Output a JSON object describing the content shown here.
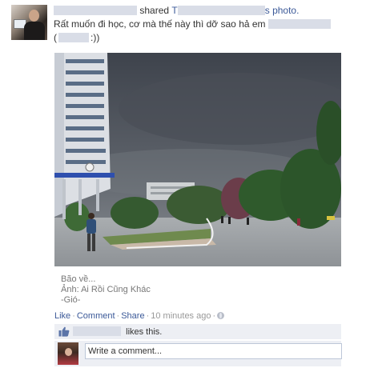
{
  "story": {
    "actor_name": "",
    "shared_text": "shared",
    "owner_prefix": "T",
    "owner_suffix": "s photo.",
    "message_line1": "Rất muốn đi học, cơ mà thế này thì dỡ sao hả em",
    "message_line2_open": "(",
    "message_line2_close": ":))"
  },
  "photo": {
    "alt": ""
  },
  "caption": {
    "lines": [
      "Bão về...",
      "Ảnh: Ai Rồi Cũng Khác",
      "-Gió-"
    ]
  },
  "actions": {
    "like": "Like",
    "comment": "Comment",
    "share": "Share",
    "separator": "·",
    "time": "10 minutes ago",
    "privacy_icon": "globe-icon"
  },
  "likes": {
    "text": "likes this."
  },
  "comment_box": {
    "placeholder": "Write a comment..."
  },
  "colors": {
    "link": "#3b5998",
    "ufi_background": "#edeff4",
    "redaction": "#d9dde7"
  }
}
